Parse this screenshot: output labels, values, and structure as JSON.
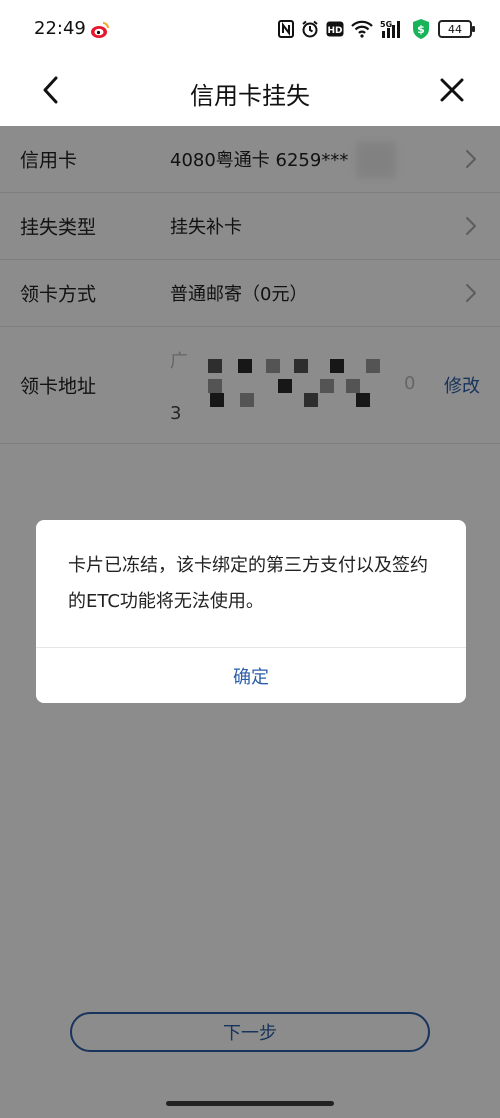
{
  "status_bar": {
    "time": "22:49",
    "signal_label": "5G",
    "hd_label": "HD",
    "battery": "44"
  },
  "header": {
    "title": "信用卡挂失"
  },
  "form": {
    "card": {
      "label": "信用卡",
      "value": "4080粤通卡 6259***"
    },
    "loss_type": {
      "label": "挂失类型",
      "value": "挂失补卡"
    },
    "pickup_method": {
      "label": "领卡方式",
      "value": "普通邮寄（0元）"
    },
    "address": {
      "label": "领卡地址",
      "line1_visible": "广",
      "line2_visible": "3",
      "trailing_char": "0",
      "modify_label": "修改"
    }
  },
  "footer": {
    "next_label": "下一步"
  },
  "dialog": {
    "message": "卡片已冻结，该卡绑定的第三方支付以及签约的ETC功能将无法使用。",
    "ok_label": "确定"
  },
  "colors": {
    "accent": "#2d5ea8",
    "overlay": "rgba(0,0,0,0.45)",
    "text": "#222222"
  }
}
